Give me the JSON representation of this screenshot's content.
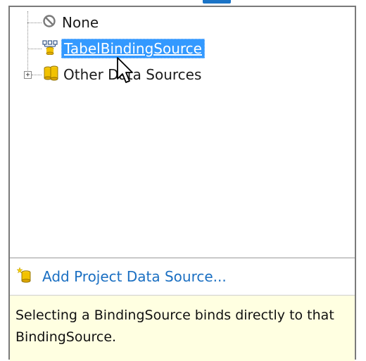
{
  "tree": {
    "items": [
      {
        "label": "None",
        "icon": "none-icon"
      },
      {
        "label": "TabelBindingSource",
        "icon": "binding-source-icon",
        "selected": true
      },
      {
        "label": "Other Data Sources",
        "icon": "database-icon",
        "expander": "+"
      }
    ],
    "overlapping_label_text": "Other Data Sources"
  },
  "add_project": {
    "label": "Add Project Data Source...",
    "icon": "add-datasource-icon"
  },
  "help": {
    "text": "Selecting a BindingSource binds directly to that BindingSource."
  },
  "colors": {
    "selection": "#3399ff",
    "link": "#1a6fc2",
    "help_background": "#ffffe1",
    "accent": "#1a73c6"
  }
}
